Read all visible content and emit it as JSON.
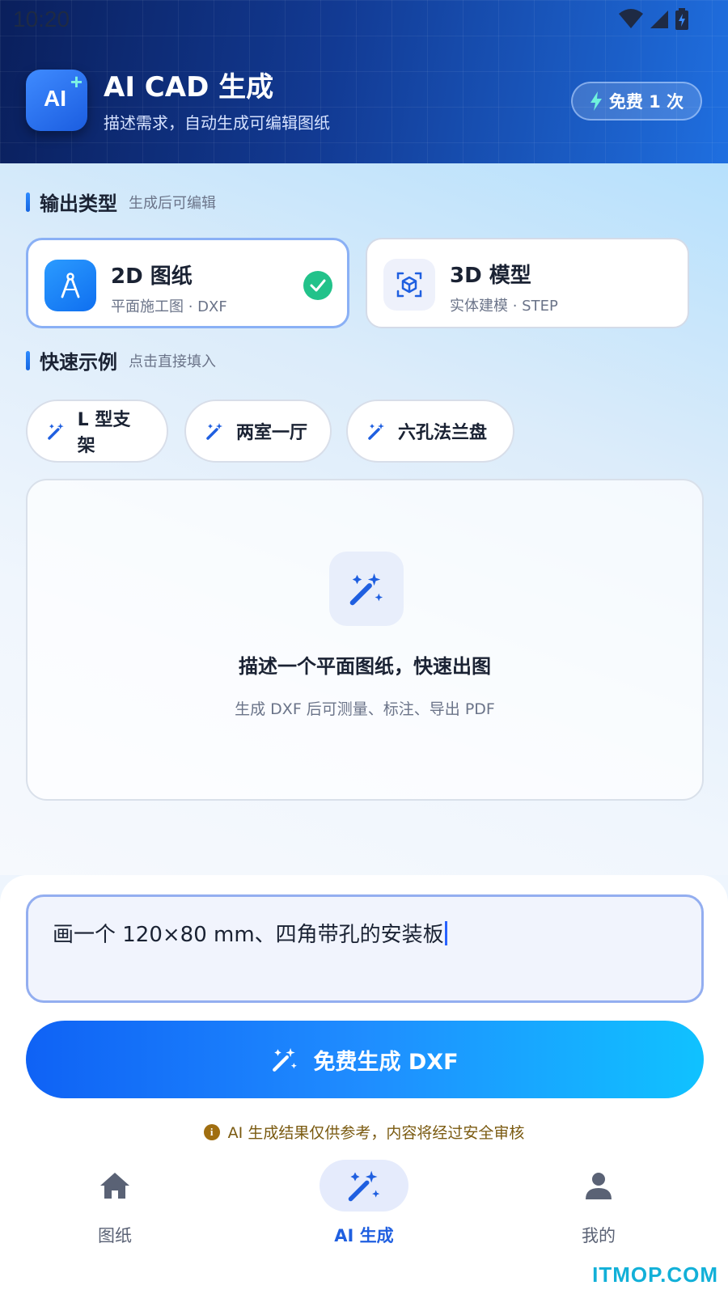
{
  "status_bar": {
    "time": "10:20"
  },
  "header": {
    "logo_text": "AI",
    "logo_plus": "+",
    "title": "AI CAD 生成",
    "subtitle": "描述需求，自动生成可编辑图纸",
    "free_badge": "免费 1 次"
  },
  "output_type": {
    "label": "输出类型",
    "hint": "生成后可编辑",
    "options": [
      {
        "title": "2D 图纸",
        "subtitle": "平面施工图 · DXF",
        "icon": "compass-icon",
        "selected": true
      },
      {
        "title": "3D 模型",
        "subtitle": "实体建模 · STEP",
        "icon": "cube-icon",
        "selected": false
      }
    ]
  },
  "examples": {
    "label": "快速示例",
    "hint": "点击直接填入",
    "chips": [
      {
        "label": "L 型支架",
        "icon": "magic-wand-icon"
      },
      {
        "label": "两室一厅",
        "icon": "magic-wand-icon"
      },
      {
        "label": "六孔法兰盘",
        "icon": "magic-wand-icon"
      }
    ]
  },
  "empty_state": {
    "icon": "magic-wand-icon",
    "title": "描述一个平面图纸，快速出图",
    "subtitle": "生成 DXF 后可测量、标注、导出 PDF"
  },
  "prompt": {
    "value": "画一个 120×80 mm、四角带孔的安装板"
  },
  "generate_button": {
    "label": "免费生成 DXF",
    "icon": "magic-wand-icon"
  },
  "notice": {
    "icon": "info-icon",
    "text": "AI 生成结果仅供参考，内容将经过安全审核"
  },
  "tab_bar": {
    "tabs": [
      {
        "label": "图纸",
        "icon": "home-icon",
        "active": false
      },
      {
        "label": "AI 生成",
        "icon": "magic-wand-icon",
        "active": true
      },
      {
        "label": "我的",
        "icon": "person-icon",
        "active": false
      }
    ]
  },
  "watermark": "ITMOP.COM",
  "colors": {
    "accent": "#1f5fe0",
    "header_dark": "#0a1f5c",
    "success": "#22c28a",
    "notice": "#7a5a10"
  }
}
